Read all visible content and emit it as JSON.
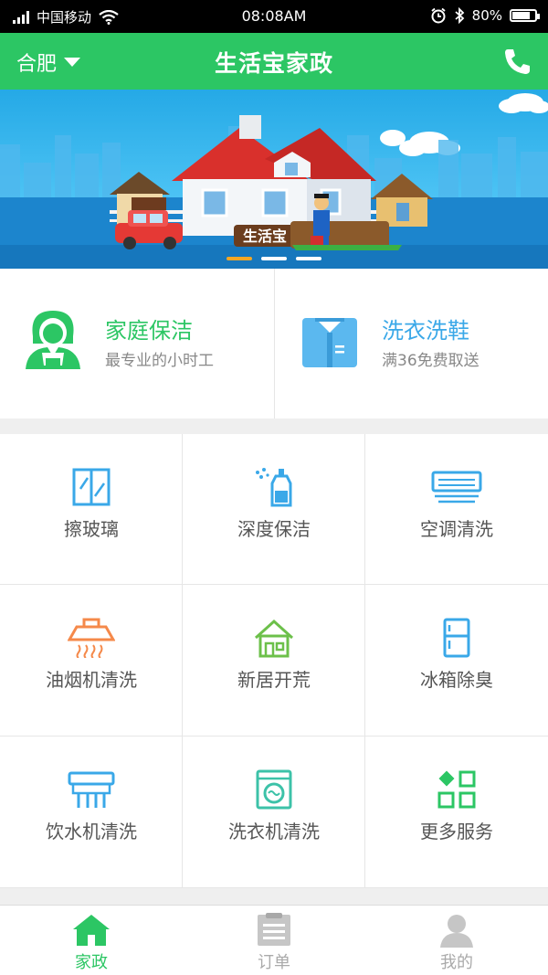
{
  "status_bar": {
    "carrier": "中国移动",
    "time": "08:08AM",
    "battery_text": "80%",
    "battery_level": 0.8
  },
  "header": {
    "city": "合肥",
    "title": "生活宝家政",
    "brand_color": "#2cc664"
  },
  "banner": {
    "sign_text": "生活宝",
    "slide_count": 3,
    "active_slide": 1
  },
  "featured": [
    {
      "title": "家庭保洁",
      "subtitle": "最专业的小时工",
      "icon": "housekeeper-icon",
      "color": "#2cc664"
    },
    {
      "title": "洗衣洗鞋",
      "subtitle": "满36免费取送",
      "icon": "shirt-icon",
      "color": "#3aa8e8"
    }
  ],
  "services": [
    {
      "label": "擦玻璃",
      "icon": "window-icon"
    },
    {
      "label": "深度保洁",
      "icon": "spray-bottle-icon"
    },
    {
      "label": "空调清洗",
      "icon": "air-conditioner-icon"
    },
    {
      "label": "油烟机清洗",
      "icon": "range-hood-icon"
    },
    {
      "label": "新居开荒",
      "icon": "house-icon"
    },
    {
      "label": "冰箱除臭",
      "icon": "fridge-icon"
    },
    {
      "label": "饮水机清洗",
      "icon": "water-dispenser-icon"
    },
    {
      "label": "洗衣机清洗",
      "icon": "washing-machine-icon"
    },
    {
      "label": "更多服务",
      "icon": "more-grid-icon"
    }
  ],
  "tabs": [
    {
      "label": "家政",
      "icon": "home-icon",
      "active": true
    },
    {
      "label": "订单",
      "icon": "order-list-icon",
      "active": false
    },
    {
      "label": "我的",
      "icon": "user-icon",
      "active": false
    }
  ]
}
